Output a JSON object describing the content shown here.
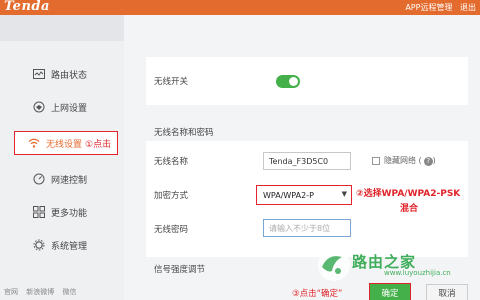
{
  "app": {
    "logo": "Tenda",
    "top_links": [
      "APP远程管理",
      "退出"
    ]
  },
  "sidebar": {
    "items": [
      {
        "label": "路由状态",
        "icon": "status-monitor-icon"
      },
      {
        "label": "上网设置",
        "icon": "globe-icon"
      },
      {
        "label": "无线设置",
        "icon": "wifi-icon",
        "annotation": "①点击"
      },
      {
        "label": "网速控制",
        "icon": "speed-gauge-icon"
      },
      {
        "label": "更多功能",
        "icon": "grid-icon"
      },
      {
        "label": "系统管理",
        "icon": "gear-icon"
      }
    ],
    "footer": [
      "官网",
      "新浪微博",
      "微信"
    ]
  },
  "main": {
    "wireless_switch": {
      "label": "无线开关",
      "on": true
    },
    "section_name_password": "无线名称和密码",
    "ssid": {
      "label": "无线名称",
      "value": "Tenda_F3D5C0",
      "hide_label": "隐藏网络",
      "help": "?"
    },
    "security": {
      "label": "加密方式",
      "value": "WPA/WPA2-P",
      "annotation_line1": "②选择WPA/WPA2-PSK",
      "annotation_line2": "混合"
    },
    "password": {
      "label": "无线密码",
      "placeholder": "请输入不少于8位"
    },
    "section_signal": "信号强度调节",
    "step3_annotation": "③点击“确定”",
    "ok_label": "确定",
    "cancel_label": "取消"
  },
  "watermark": {
    "text": "路由之家",
    "url": "www.luyouzhijia.cn"
  },
  "colors": {
    "brand": "#e36b2d",
    "accent": "#43b049",
    "annotation": "#e0242a"
  }
}
